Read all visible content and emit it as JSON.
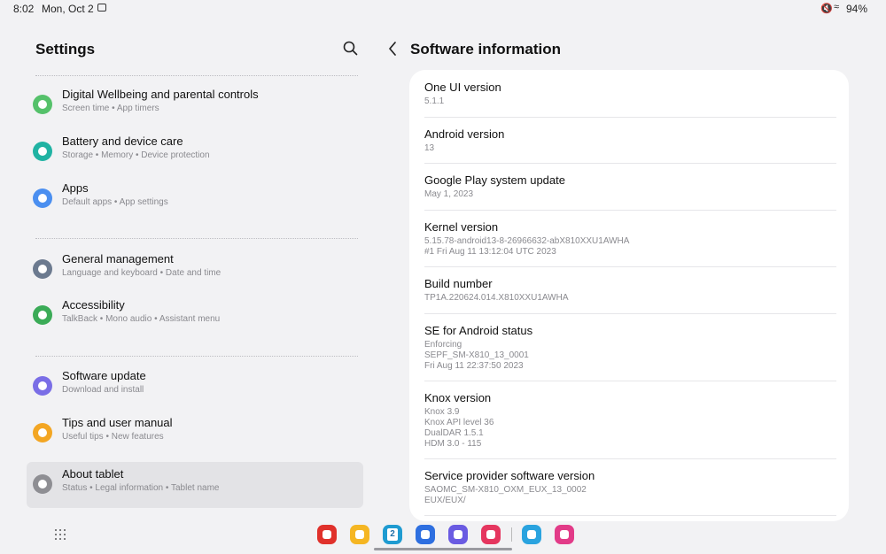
{
  "status_bar": {
    "time": "8:02",
    "date": "Mon, Oct 2",
    "battery": "94%",
    "icons": [
      "image-icon",
      "mute-icon",
      "wifi-icon"
    ]
  },
  "left_pane": {
    "title": "Settings",
    "search_icon": "search-icon",
    "items": [
      {
        "label": "Digital Wellbeing and parental controls",
        "subtitle": "Screen time  •  App timers",
        "icon": "digital-wellbeing-icon",
        "color": "#55c16a"
      },
      {
        "label": "Battery and device care",
        "subtitle": "Storage  •  Memory  •  Device protection",
        "icon": "device-care-icon",
        "color": "#20b3a3"
      },
      {
        "label": "Apps",
        "subtitle": "Default apps  •  App settings",
        "icon": "apps-icon",
        "color": "#4b8ff0"
      },
      {
        "label": "General management",
        "subtitle": "Language and keyboard  •  Date and time",
        "icon": "sliders-icon",
        "color": "#6c7a8f"
      },
      {
        "label": "Accessibility",
        "subtitle": "TalkBack  •  Mono audio  •  Assistant menu",
        "icon": "accessibility-icon",
        "color": "#3bab57"
      },
      {
        "label": "Software update",
        "subtitle": "Download and install",
        "icon": "software-update-icon",
        "color": "#7a6ee6"
      },
      {
        "label": "Tips and user manual",
        "subtitle": "Useful tips  •  New features",
        "icon": "lightbulb-icon",
        "color": "#f3a623"
      },
      {
        "label": "About tablet",
        "subtitle": "Status  •  Legal information  •  Tablet name",
        "icon": "info-icon",
        "color": "#8e8e93"
      }
    ]
  },
  "right_pane": {
    "title": "Software information",
    "back_icon": "back-arrow-icon",
    "rows": [
      {
        "title": "One UI version",
        "value": "5.1.1"
      },
      {
        "title": "Android version",
        "value": "13"
      },
      {
        "title": "Google Play system update",
        "value": "May 1, 2023"
      },
      {
        "title": "Kernel version",
        "value": "5.15.78-android13-8-26966632-abX810XXU1AWHA\n#1 Fri Aug 11 13:12:04 UTC 2023"
      },
      {
        "title": "Build number",
        "value": "TP1A.220624.014.X810XXU1AWHA"
      },
      {
        "title": "SE for Android status",
        "value": "Enforcing\nSEPF_SM-X810_13_0001\nFri Aug 11 22:37:50 2023"
      },
      {
        "title": "Knox version",
        "value": "Knox 3.9\nKnox API level 36\nDualDAR 1.5.1\nHDM 3.0 - 115"
      },
      {
        "title": "Service provider software version",
        "value": "SAOMC_SM-X810_OXM_EUX_13_0002\nEUX/EUX/"
      }
    ]
  },
  "dock": {
    "apps": [
      {
        "icon": "flipboard-icon",
        "color": "#e0312b"
      },
      {
        "icon": "my-files-icon",
        "color": "#f5b623"
      },
      {
        "icon": "calendar-icon",
        "color": "#1f9bd1"
      },
      {
        "icon": "messages-icon",
        "color": "#2e6fe0"
      },
      {
        "icon": "internet-icon",
        "color": "#6a5be2"
      },
      {
        "icon": "camera-icon",
        "color": "#e5365f"
      },
      {
        "icon": "telegram-icon",
        "color": "#2aa3df"
      },
      {
        "icon": "blossom-icon",
        "color": "#e23b88"
      }
    ],
    "calendar_day": "2"
  }
}
